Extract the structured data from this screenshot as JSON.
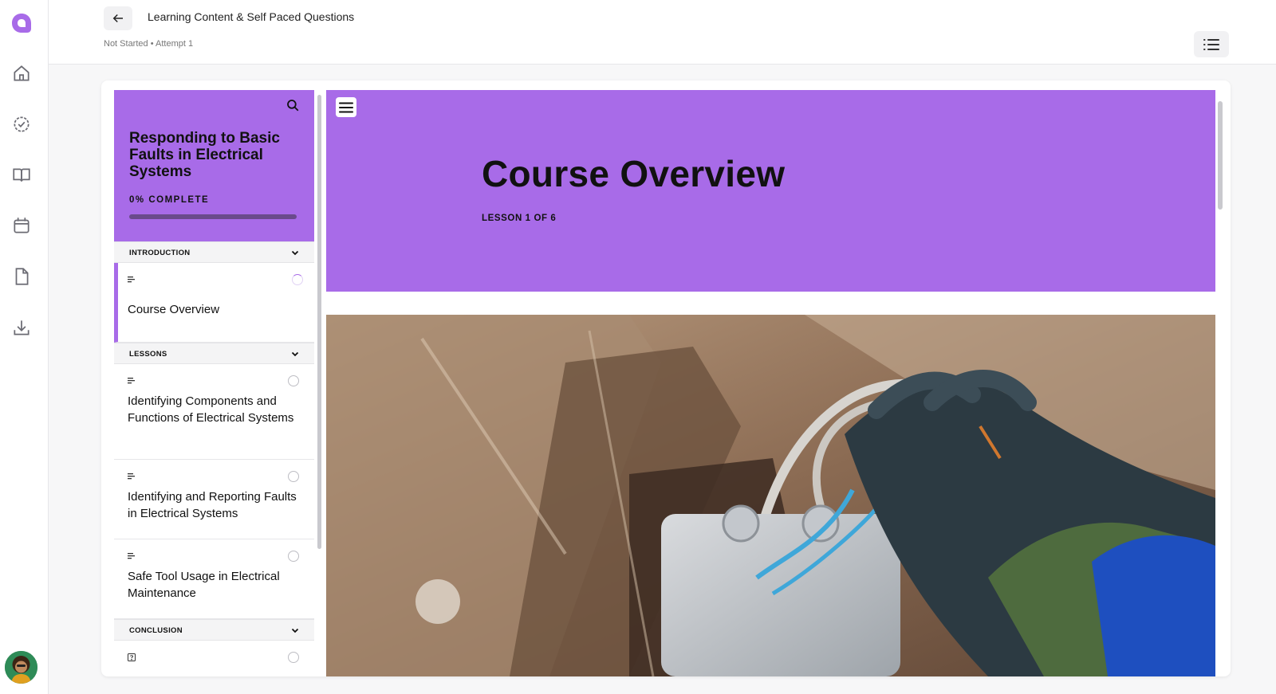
{
  "header": {
    "title": "Learning Content & Self Paced Questions",
    "status_line": "Not Started • Attempt 1"
  },
  "rail": {
    "icons": [
      "logo-icon",
      "home-icon",
      "check-circle-icon",
      "book-icon",
      "calendar-icon",
      "document-icon",
      "download-icon"
    ]
  },
  "course": {
    "title": "Responding to Basic Faults in Electrical Systems",
    "progress_label": "0% COMPLETE",
    "progress": 0,
    "sections": [
      {
        "label": "INTRODUCTION",
        "items": [
          {
            "label": "Course Overview",
            "active": true
          }
        ]
      },
      {
        "label": "LESSONS",
        "items": [
          {
            "label": "Identifying Components and Functions of Electrical Systems"
          },
          {
            "label": "Identifying and Reporting Faults in Electrical Systems"
          },
          {
            "label": "Safe Tool Usage in Electrical Maintenance"
          }
        ]
      },
      {
        "label": "CONCLUSION",
        "items": [
          {
            "label": ""
          }
        ]
      }
    ]
  },
  "lesson": {
    "title": "Course Overview",
    "subtitle": "LESSON 1 OF 6"
  },
  "colors": {
    "accent": "#a86be8",
    "progress_track": "#6a4a8c"
  }
}
